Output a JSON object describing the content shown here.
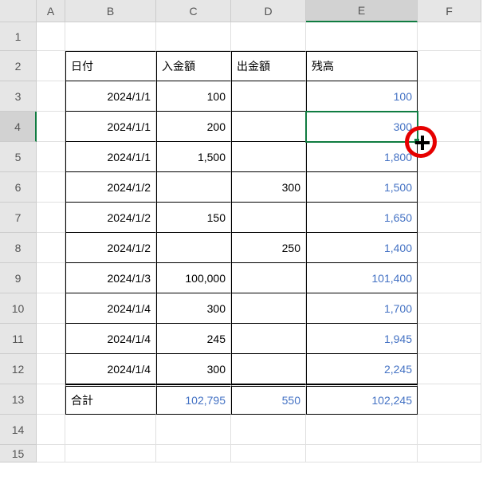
{
  "columns": [
    "A",
    "B",
    "C",
    "D",
    "E",
    "F"
  ],
  "active_col": "E",
  "active_row": "4",
  "row_count": 15,
  "headers": {
    "date": "日付",
    "deposit": "入金額",
    "withdraw": "出金額",
    "balance": "残高"
  },
  "rows": [
    {
      "date": "2024/1/1",
      "deposit": "100",
      "withdraw": "",
      "balance": "100"
    },
    {
      "date": "2024/1/1",
      "deposit": "200",
      "withdraw": "",
      "balance": "300"
    },
    {
      "date": "2024/1/1",
      "deposit": "1,500",
      "withdraw": "",
      "balance": "1,800"
    },
    {
      "date": "2024/1/2",
      "deposit": "",
      "withdraw": "300",
      "balance": "1,500"
    },
    {
      "date": "2024/1/2",
      "deposit": "150",
      "withdraw": "",
      "balance": "1,650"
    },
    {
      "date": "2024/1/2",
      "deposit": "",
      "withdraw": "250",
      "balance": "1,400"
    },
    {
      "date": "2024/1/3",
      "deposit": "100,000",
      "withdraw": "",
      "balance": "101,400"
    },
    {
      "date": "2024/1/4",
      "deposit": "300",
      "withdraw": "",
      "balance": "1,700"
    },
    {
      "date": "2024/1/4",
      "deposit": "245",
      "withdraw": "",
      "balance": "1,945"
    },
    {
      "date": "2024/1/4",
      "deposit": "300",
      "withdraw": "",
      "balance": "2,245"
    }
  ],
  "totals": {
    "label": "合計",
    "deposit": "102,795",
    "withdraw": "550",
    "balance": "102,245"
  },
  "chart_data": {
    "type": "table",
    "title": "入出金台帳",
    "columns": [
      "日付",
      "入金額",
      "出金額",
      "残高"
    ],
    "data": [
      [
        "2024/1/1",
        100,
        null,
        100
      ],
      [
        "2024/1/1",
        200,
        null,
        300
      ],
      [
        "2024/1/1",
        1500,
        null,
        1800
      ],
      [
        "2024/1/2",
        null,
        300,
        1500
      ],
      [
        "2024/1/2",
        150,
        null,
        1650
      ],
      [
        "2024/1/2",
        null,
        250,
        1400
      ],
      [
        "2024/1/3",
        100000,
        null,
        101400
      ],
      [
        "2024/1/4",
        300,
        null,
        1700
      ],
      [
        "2024/1/4",
        245,
        null,
        1945
      ],
      [
        "2024/1/4",
        300,
        null,
        2245
      ]
    ],
    "totals": {
      "入金額": 102795,
      "出金額": 550,
      "残高": 102245
    }
  }
}
